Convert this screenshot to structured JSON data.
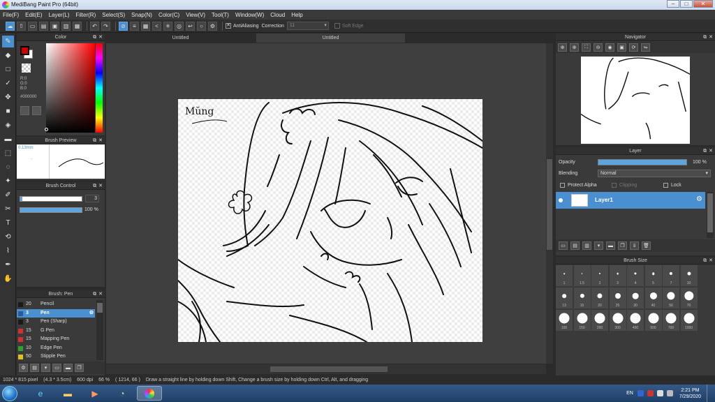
{
  "window": {
    "title": "MediBang Paint Pro (64bit)",
    "controls": [
      "–",
      "□",
      "✕"
    ]
  },
  "menu": [
    "File(F)",
    "Edit(E)",
    "Layer(L)",
    "Filter(R)",
    "Select(S)",
    "Snap(N)",
    "Color(C)",
    "View(V)",
    "Tool(T)",
    "Window(W)",
    "Cloud",
    "Help"
  ],
  "toolbar": {
    "antialiasing_label": "AntiAliasing",
    "correction_label": "Correction",
    "correction_value": "11",
    "soft_edge_label": "Soft Edge"
  },
  "color_panel": {
    "title": "Color",
    "r": "R:0",
    "g": "G:0",
    "b": "B:0",
    "hex": "#000000",
    "foreground": "#cc0000",
    "background": "#ffffff"
  },
  "brush_preview": {
    "title": "Brush Preview",
    "size": "0.13mm",
    "dot": "."
  },
  "brush_control": {
    "title": "Brush Control",
    "size_value": "3",
    "opacity_value": "100 %",
    "opacity": 1.0
  },
  "brush_list": {
    "title": "Brush: Pen",
    "items": [
      {
        "num": "20",
        "name": "Pencil",
        "color": "#1a1a1a"
      },
      {
        "num": "3",
        "name": "Pen",
        "color": "#2a5a9a"
      },
      {
        "num": "3",
        "name": "Pen (Sharp)",
        "color": "#1a1a1a"
      },
      {
        "num": "15",
        "name": "G Pen",
        "color": "#d03030"
      },
      {
        "num": "15",
        "name": "Mapping Pen",
        "color": "#d03030"
      },
      {
        "num": "10",
        "name": "Edge Pen",
        "color": "#30a030"
      },
      {
        "num": "50",
        "name": "Stipple Pen",
        "color": "#e0c020"
      }
    ]
  },
  "document": {
    "tabs": [
      "Untitled",
      "Untitled"
    ],
    "signature": "Mŭng"
  },
  "navigator": {
    "title": "Navigator"
  },
  "layer_panel": {
    "title": "Layer",
    "opacity_label": "Opacity",
    "opacity_value": "100 %",
    "opacity": 1.0,
    "blending_label": "Blending",
    "blending_value": "Normal",
    "protect_alpha": "Protect Alpha",
    "clipping": "Clipping",
    "lock": "Lock",
    "layer_name": "Layer1"
  },
  "brush_size": {
    "title": "Brush Size",
    "sizes": [
      "1",
      "1.5",
      "2",
      "3",
      "4",
      "5",
      "7",
      "10",
      "13",
      "15",
      "20",
      "25",
      "30",
      "40",
      "50",
      "70",
      "100",
      "150",
      "200",
      "300",
      "400",
      "500",
      "700",
      "1000"
    ]
  },
  "status": {
    "dimensions": "1024 * 815 pixel",
    "size_cm": "(4.3 * 3.5cm)",
    "dpi": "600 dpi",
    "zoom": "66 %",
    "coords": "( 1214, 66 )",
    "hint": "Draw a straight line by holding down Shift, Change a brush size by holding down Ctrl, Alt, and dragging"
  },
  "taskbar": {
    "language": "EN",
    "time": "2:21 PM",
    "date": "7/29/2020"
  }
}
